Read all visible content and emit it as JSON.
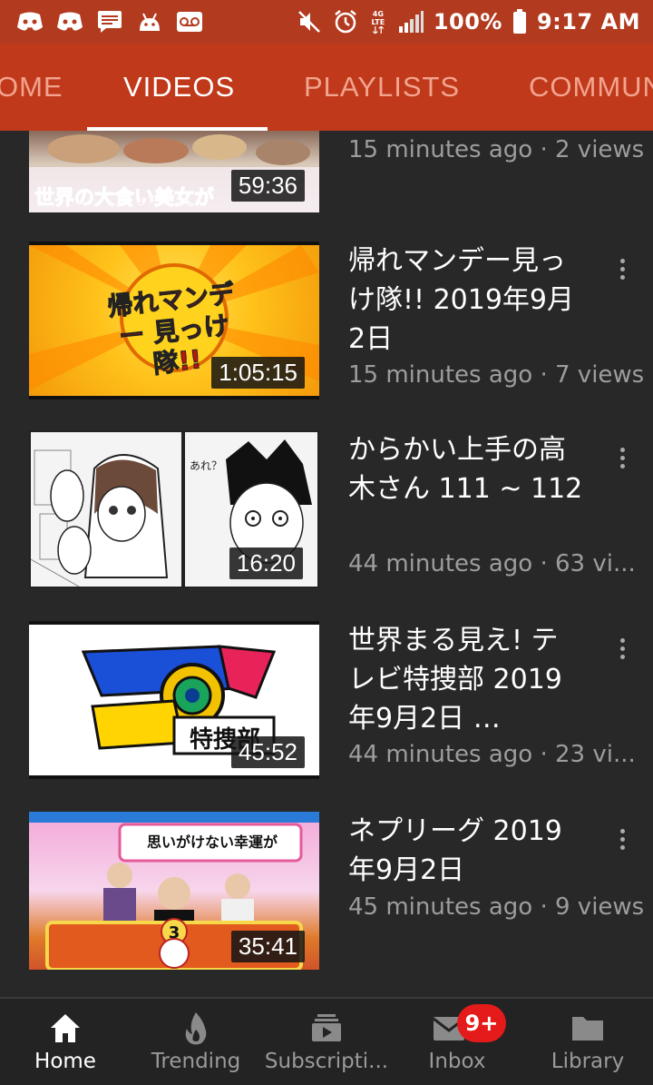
{
  "status_bar": {
    "battery": "100%",
    "time": "9:17 AM",
    "network": "4G LTE",
    "icons_left": [
      "discord-icon",
      "discord-icon",
      "message-icon",
      "android-icon",
      "voicemail-icon"
    ],
    "icons_right": [
      "mute-icon",
      "alarm-icon",
      "lte-icon",
      "signal-icon",
      "battery-icon"
    ]
  },
  "tabs": [
    {
      "label": "OME",
      "active": false
    },
    {
      "label": "VIDEOS",
      "active": true
    },
    {
      "label": "PLAYLISTS",
      "active": false
    },
    {
      "label": "COMMUN",
      "active": false
    }
  ],
  "videos": [
    {
      "title": "",
      "meta": "15 minutes ago · 2 views",
      "duration": "59:36",
      "thumb_text": "世界の大食い美女が"
    },
    {
      "title": "帰れマンデー見っけ隊!! 2019年9月2日",
      "meta": "15 minutes ago · 7 views",
      "duration": "1:05:15",
      "thumb_text": "帰れマンデー 見っけ隊!!"
    },
    {
      "title": "からかい上手の高木さん 111 ~ 112",
      "meta": "44 minutes ago · 63 vi...",
      "duration": "16:20",
      "thumb_text": "あれ？"
    },
    {
      "title": "世界まる見え! テレビ特捜部 2019年9月2日 …",
      "meta": "44 minutes ago · 23 vi...",
      "duration": "45:52",
      "thumb_text": "特捜部"
    },
    {
      "title": "ネプリーグ 2019年9月2日",
      "meta": "45 minutes ago · 9 views",
      "duration": "35:41",
      "thumb_text": "思いがけない幸運が"
    }
  ],
  "bottom_nav": [
    {
      "label": "Home",
      "icon": "home-icon",
      "active": true
    },
    {
      "label": "Trending",
      "icon": "flame-icon",
      "active": false
    },
    {
      "label": "Subscripti...",
      "icon": "subscriptions-icon",
      "active": false
    },
    {
      "label": "Inbox",
      "icon": "mail-icon",
      "active": false,
      "badge": "9+"
    },
    {
      "label": "Library",
      "icon": "folder-icon",
      "active": false
    }
  ],
  "colors": {
    "status_bar": "#b23a1f",
    "tab_bar": "#c0391b",
    "background": "#282828",
    "badge": "#e51a1a"
  }
}
